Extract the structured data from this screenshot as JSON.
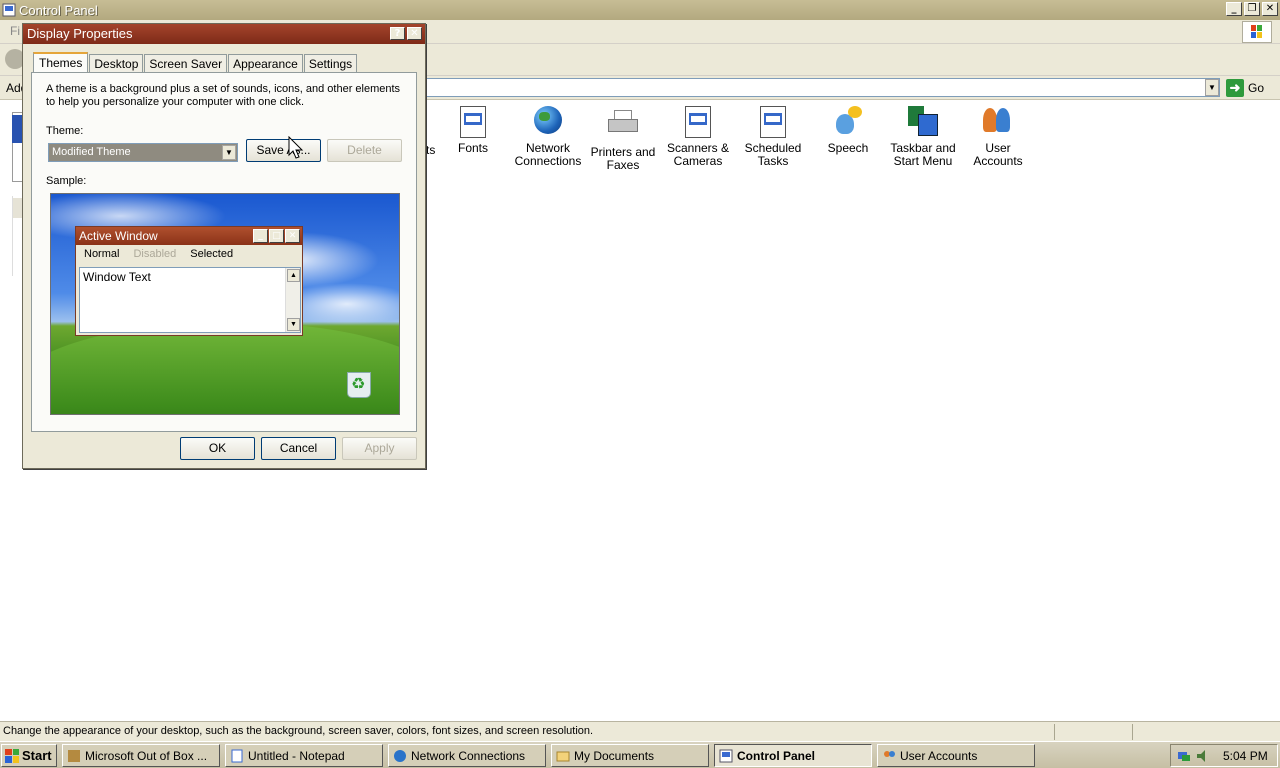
{
  "control_panel": {
    "title": "Control Panel",
    "menu_first": "Fi",
    "address_label": "Add",
    "go_label": "Go",
    "fragment_text": "ts",
    "icons": [
      {
        "name": "fonts",
        "label": "Fonts"
      },
      {
        "name": "network-connections",
        "label": "Network Connections"
      },
      {
        "name": "printers-and-faxes",
        "label": "Printers and Faxes"
      },
      {
        "name": "scanners-cameras",
        "label": "Scanners & Cameras"
      },
      {
        "name": "scheduled-tasks",
        "label": "Scheduled Tasks"
      },
      {
        "name": "speech",
        "label": "Speech"
      },
      {
        "name": "taskbar-start-menu",
        "label": "Taskbar and Start Menu"
      },
      {
        "name": "user-accounts",
        "label": "User Accounts"
      }
    ],
    "status_text": "Change the appearance of your desktop, such as the background, screen saver, colors, font sizes, and screen resolution."
  },
  "dialog": {
    "title": "Display Properties",
    "tabs": [
      "Themes",
      "Desktop",
      "Screen Saver",
      "Appearance",
      "Settings"
    ],
    "selected_tab": "Themes",
    "description": "A theme is a background plus a set of sounds, icons, and other elements to help you personalize your computer with one click.",
    "theme_label": "Theme:",
    "theme_value": "Modified Theme",
    "save_as_label": "Save As...",
    "delete_label": "Delete",
    "sample_label": "Sample:",
    "sample_window": {
      "title": "Active Window",
      "menu_normal": "Normal",
      "menu_disabled": "Disabled",
      "menu_selected": "Selected",
      "window_text": "Window Text"
    },
    "ok_label": "OK",
    "cancel_label": "Cancel",
    "apply_label": "Apply"
  },
  "taskbar": {
    "start_label": "Start",
    "tasks": [
      {
        "label": "Microsoft Out of Box ...",
        "active": false
      },
      {
        "label": "Untitled - Notepad",
        "active": false
      },
      {
        "label": "Network Connections",
        "active": false
      },
      {
        "label": "My Documents",
        "active": false
      },
      {
        "label": "Control Panel",
        "active": true
      },
      {
        "label": "User Accounts",
        "active": false
      }
    ],
    "clock": "5:04 PM"
  },
  "colors": {
    "dialog_title": "#8a3218",
    "desktop_sky": "#1a58d0",
    "tab_accent": "#e5a53a"
  }
}
